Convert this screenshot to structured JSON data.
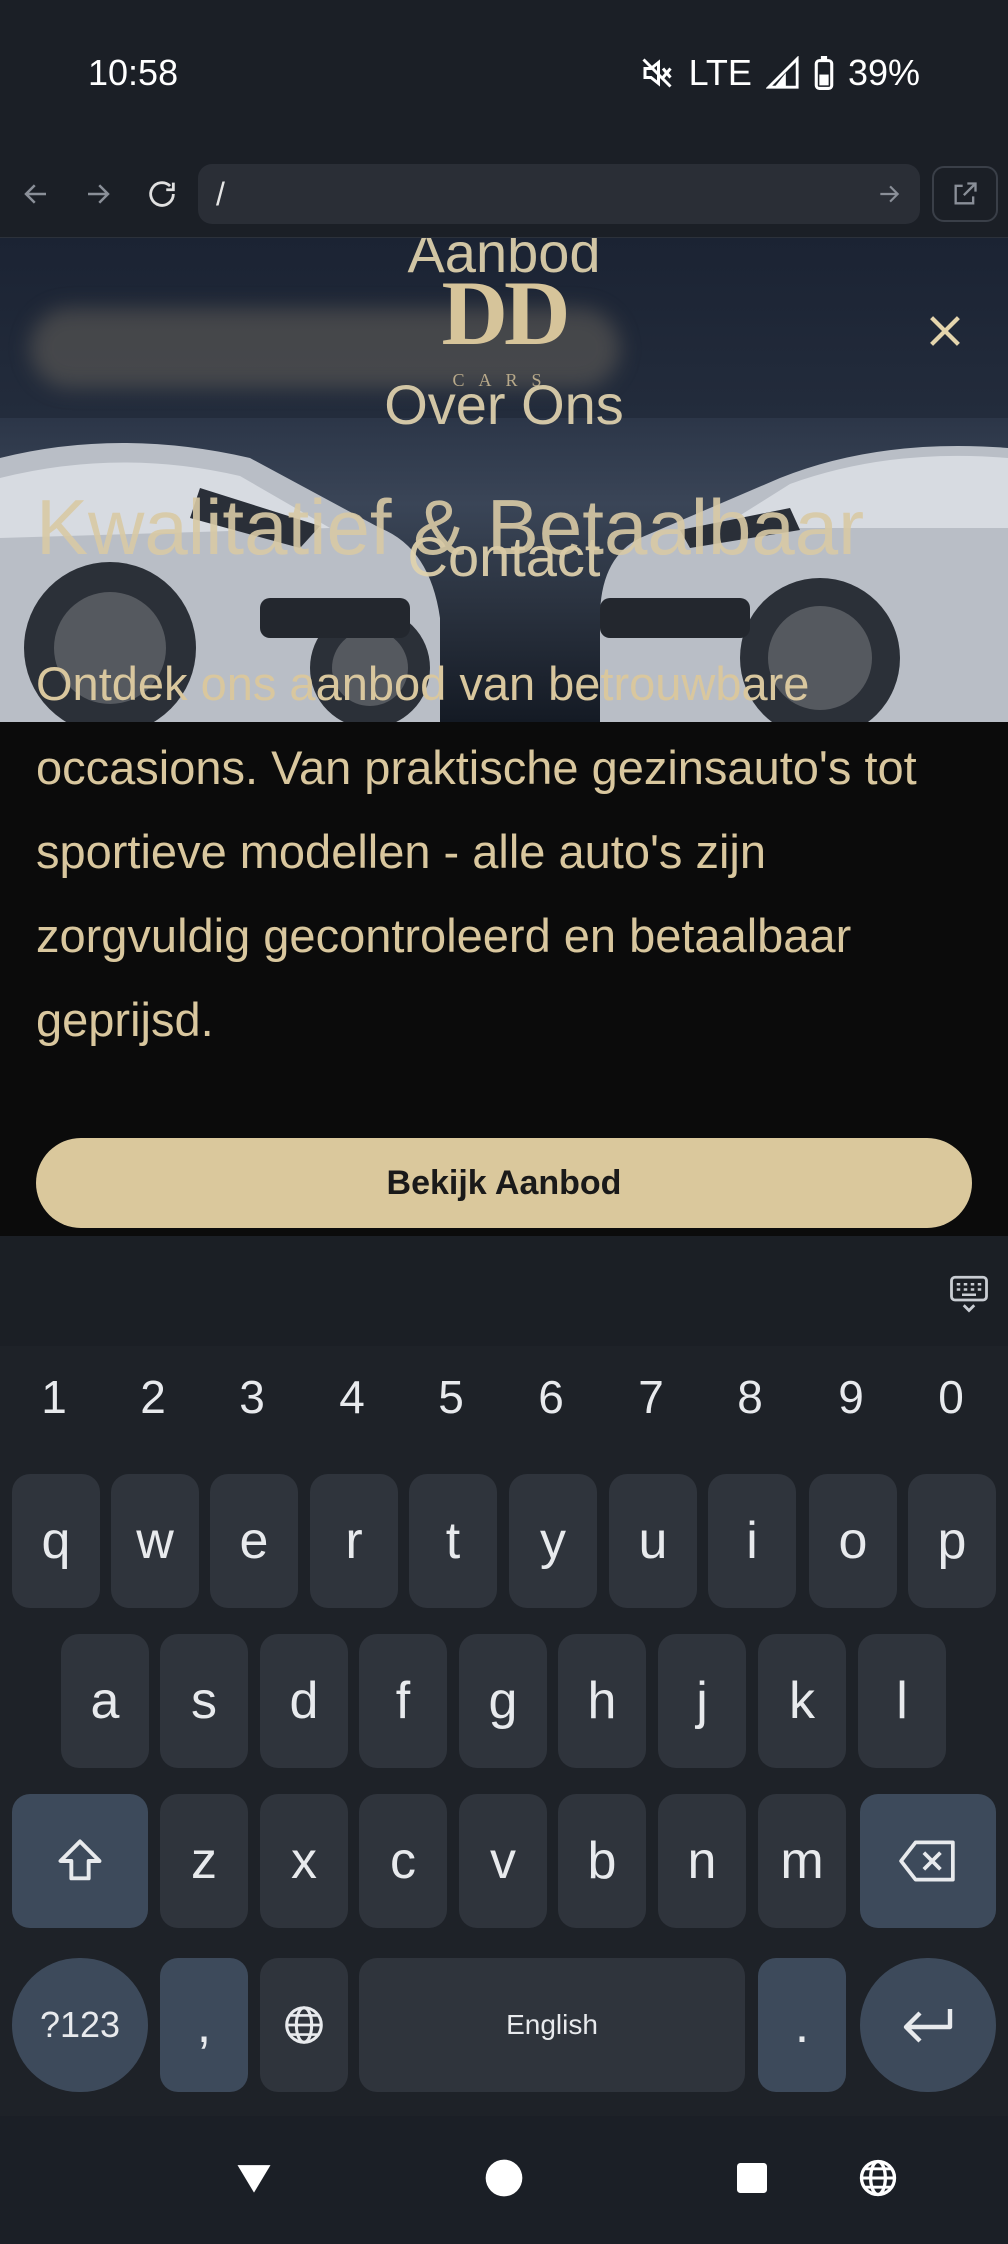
{
  "status_bar": {
    "time": "10:58",
    "network": "LTE",
    "battery": "39%",
    "icons": [
      "mute-icon",
      "signal-icon",
      "battery-icon"
    ]
  },
  "browser": {
    "url": "/",
    "icons": [
      "back-arrow-icon",
      "forward-arrow-icon",
      "reload-icon",
      "go-arrow-icon",
      "open-external-icon"
    ]
  },
  "site": {
    "logo_text": "DD",
    "logo_subtext": "CARS",
    "menu": [
      "Aanbod",
      "Over Ons",
      "Contact"
    ],
    "hero_title": "Kwalitatief & Betaalbaar",
    "description": "Ontdek ons aanbod van betrouwbare occasions. Van praktische gezinsauto's tot sportieve modellen - alle auto's zijn zorgvuldig gecontroleerd en betaalbaar geprijsd.",
    "cta_label": "Bekijk Aanbod"
  },
  "keyboard": {
    "numbers": [
      "1",
      "2",
      "3",
      "4",
      "5",
      "6",
      "7",
      "8",
      "9",
      "0"
    ],
    "row1": [
      "q",
      "w",
      "e",
      "r",
      "t",
      "y",
      "u",
      "i",
      "o",
      "p"
    ],
    "row2": [
      "a",
      "s",
      "d",
      "f",
      "g",
      "h",
      "j",
      "k",
      "l"
    ],
    "row3": [
      "z",
      "x",
      "c",
      "v",
      "b",
      "n",
      "m"
    ],
    "symbols_label": "?123",
    "comma": ",",
    "space_label": "English",
    "period": "."
  },
  "colors": {
    "accent_gold": "#dac89c",
    "page_bg": "#0b0b0b",
    "keyboard_bg": "#1e2228"
  }
}
